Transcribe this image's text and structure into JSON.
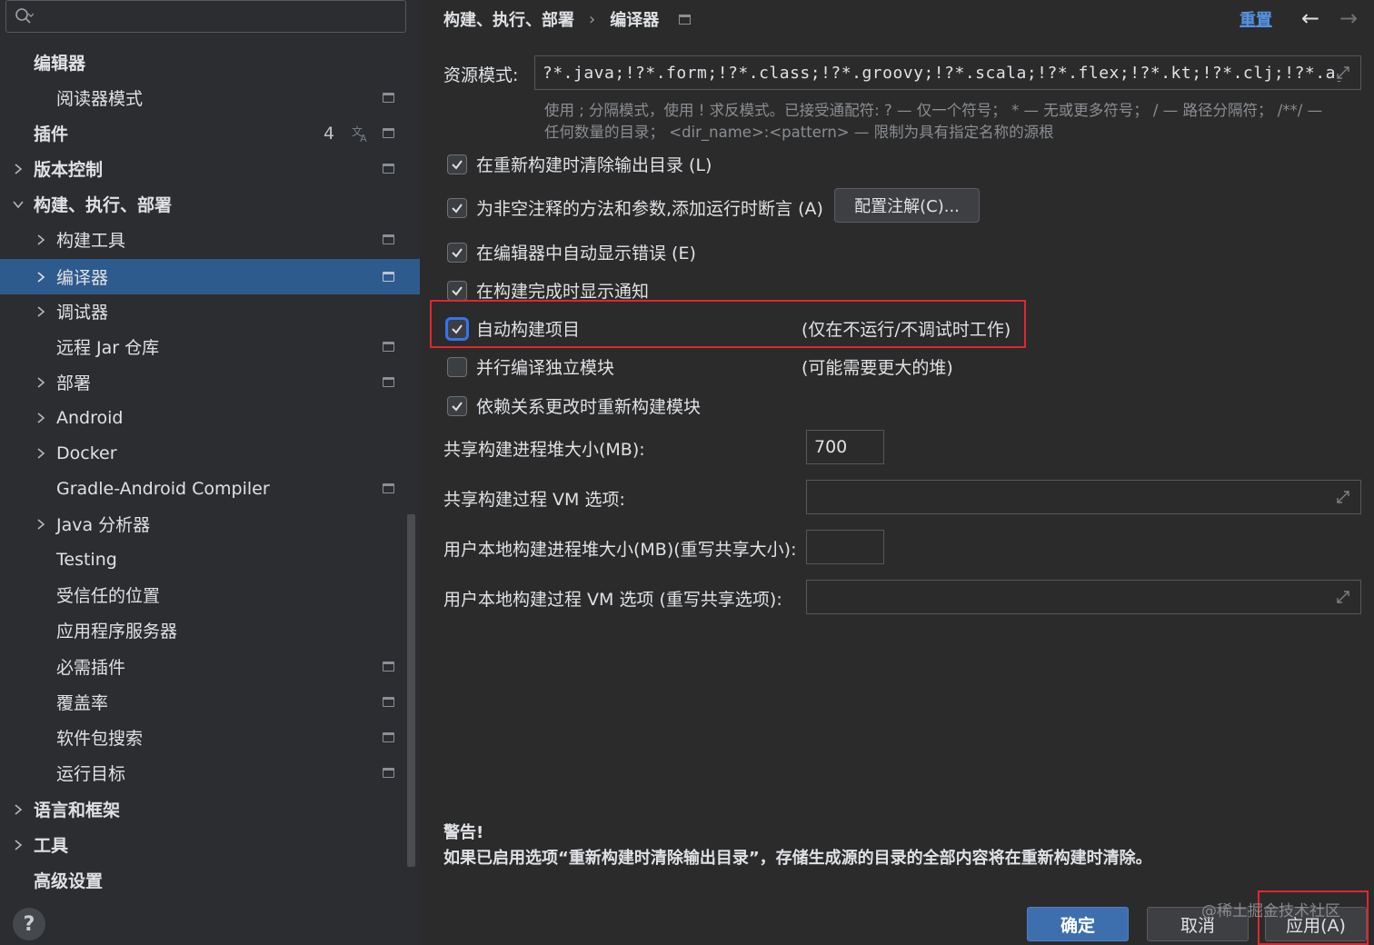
{
  "search": {
    "placeholder": ""
  },
  "sidebar": {
    "items": [
      {
        "label": "编辑器",
        "bold": true
      },
      {
        "label": "阅读器模式"
      },
      {
        "label": "插件",
        "bold": true,
        "count": "4"
      },
      {
        "label": "版本控制",
        "bold": true
      },
      {
        "label": "构建、执行、部署",
        "bold": true
      },
      {
        "label": "构建工具"
      },
      {
        "label": "编译器"
      },
      {
        "label": "调试器"
      },
      {
        "label": "远程 Jar 仓库"
      },
      {
        "label": "部署"
      },
      {
        "label": "Android"
      },
      {
        "label": "Docker"
      },
      {
        "label": "Gradle-Android Compiler"
      },
      {
        "label": "Java 分析器"
      },
      {
        "label": "Testing"
      },
      {
        "label": "受信任的位置"
      },
      {
        "label": "应用程序服务器"
      },
      {
        "label": "必需插件"
      },
      {
        "label": "覆盖率"
      },
      {
        "label": "软件包搜索"
      },
      {
        "label": "运行目标"
      },
      {
        "label": "语言和框架",
        "bold": true
      },
      {
        "label": "工具",
        "bold": true
      },
      {
        "label": "高级设置",
        "bold": true
      }
    ],
    "help_label": "?"
  },
  "header": {
    "breadcrumb_parent": "构建、执行、部署",
    "breadcrumb_sep": "›",
    "breadcrumb_current": "编译器",
    "reset_label": "重置",
    "back_label": "←",
    "forward_label": "→"
  },
  "resource": {
    "label": "资源模式:",
    "value": "?*.java;!?*.form;!?*.class;!?*.groovy;!?*.scala;!?*.flex;!?*.kt;!?*.clj;!?*.aj",
    "hint_line1": "使用 ; 分隔模式，使用 ! 求反模式。已接受通配符: ? — 仅一个符号； * — 无或更多符号； / — 路径分隔符； /**/ —",
    "hint_line2": "任何数量的目录； <dir_name>:<pattern> — 限制为具有指定名称的源根"
  },
  "options": {
    "clear_output": {
      "label": "在重新构建时清除输出目录 (L)",
      "checked": true
    },
    "add_assertions": {
      "label": "为非空注释的方法和参数,添加运行时断言 (A)",
      "checked": true
    },
    "configure_button": "配置注解(C)...",
    "auto_show_errors": {
      "label": "在编辑器中自动显示错误 (E)",
      "checked": true
    },
    "show_notification": {
      "label": "在构建完成时显示通知",
      "checked": true
    },
    "auto_build": {
      "label": "自动构建项目",
      "checked": true,
      "note": "(仅在不运行/不调试时工作)"
    },
    "parallel_compile": {
      "label": "并行编译独立模块",
      "checked": false,
      "note": "(可能需要更大的堆)"
    },
    "rebuild_on_dep_change": {
      "label": "依赖关系更改时重新构建模块",
      "checked": true
    }
  },
  "fields": {
    "shared_heap_label": "共享构建进程堆大小(MB):",
    "shared_heap_value": "700",
    "shared_vm_label": "共享构建过程 VM 选项:",
    "shared_vm_value": "",
    "local_heap_label": "用户本地构建进程堆大小(MB)(重写共享大小):",
    "local_heap_value": "",
    "local_vm_label": "用户本地构建过程 VM 选项 (重写共享选项):",
    "local_vm_value": ""
  },
  "warning": {
    "title": "警告!",
    "text": "如果已启用选项“重新构建时清除输出目录”，存储生成源的目录的全部内容将在重新构建时清除。"
  },
  "footer": {
    "ok_label": "确定",
    "cancel_label": "取消",
    "apply_label": "应用(A)",
    "watermark": "@稀土掘金技术社区"
  },
  "colors": {
    "background": "#2b2b2b",
    "selection": "#2e5b8d",
    "link": "#5594e3",
    "highlight_border": "#e0262f",
    "ok_button": "#3d6fae"
  }
}
